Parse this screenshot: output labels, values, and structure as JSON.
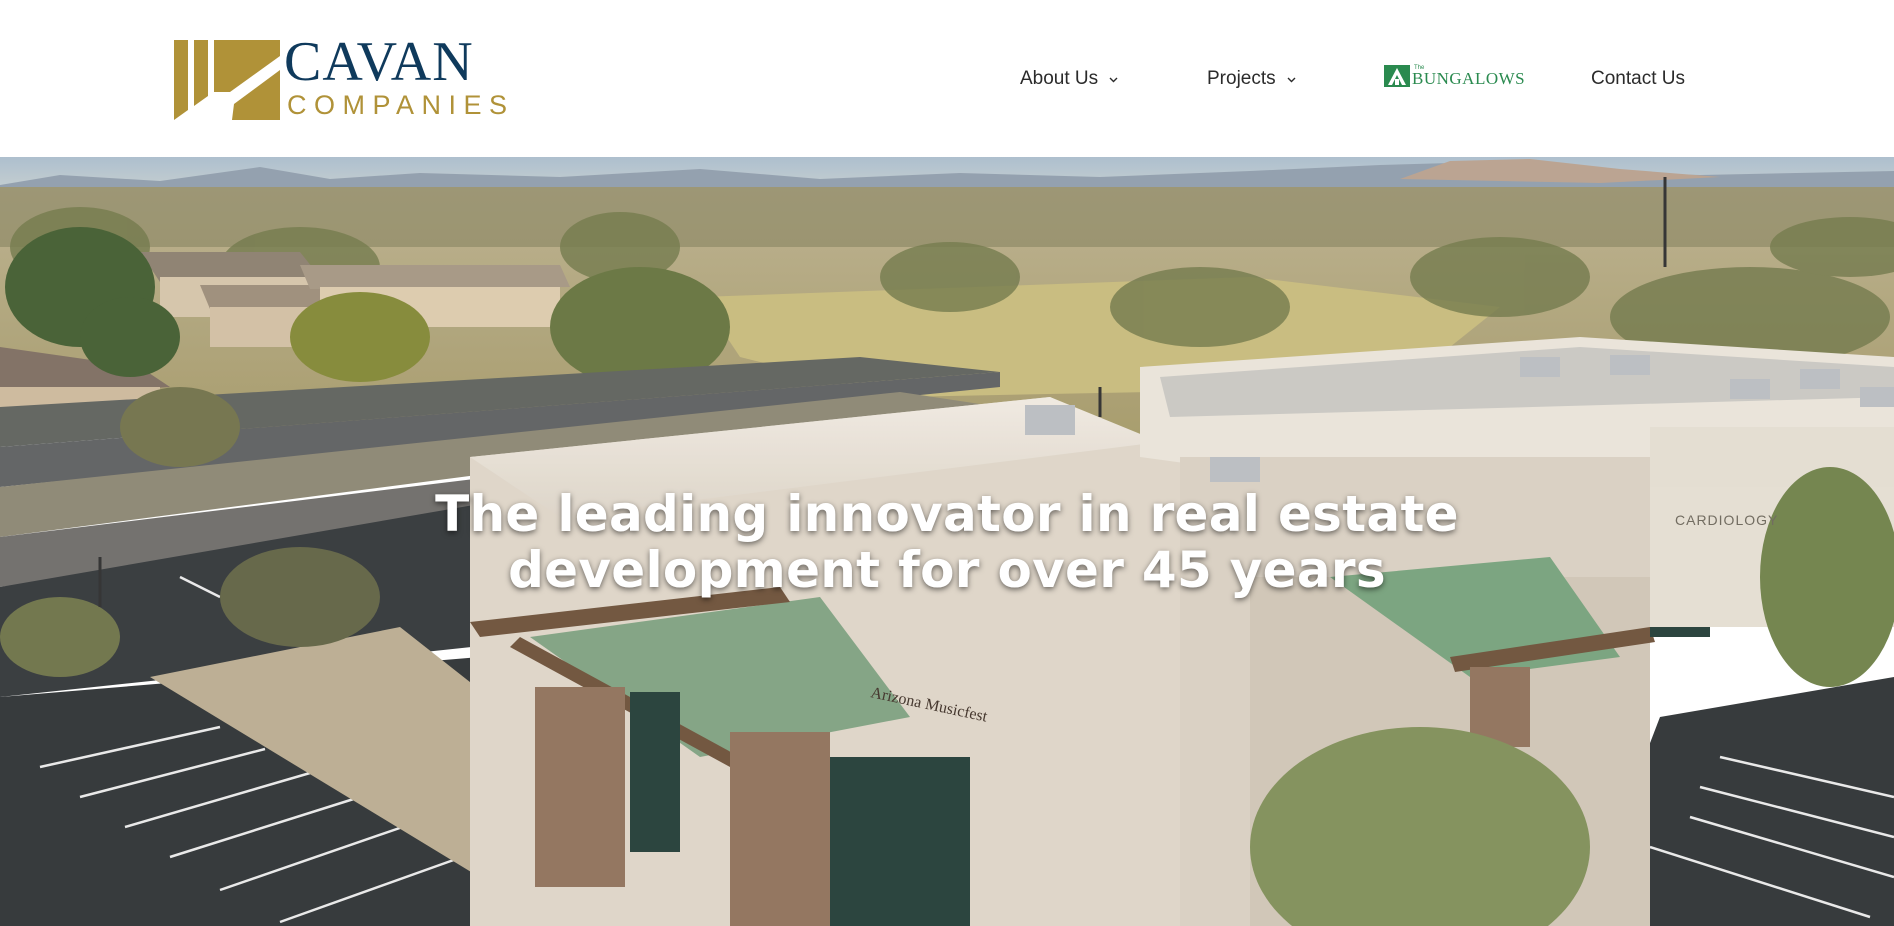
{
  "brand": {
    "name_line1": "CAVAN",
    "name_line2": "COMPANIES",
    "gold": "#b09238",
    "navy": "#0f3a5c"
  },
  "nav": {
    "about_label": "About Us",
    "projects_label": "Projects",
    "bungalows_small": "The",
    "bungalows_name": "BUNGALOWS",
    "contact_label": "Contact Us",
    "bungalows_color": "#2a8a4f"
  },
  "hero": {
    "line1": "The leading innovator in real estate",
    "line2": "development for over 45 years",
    "sign_business": "Arizona Musicfest",
    "sign_cardiology": "CARDIOLOGY"
  }
}
